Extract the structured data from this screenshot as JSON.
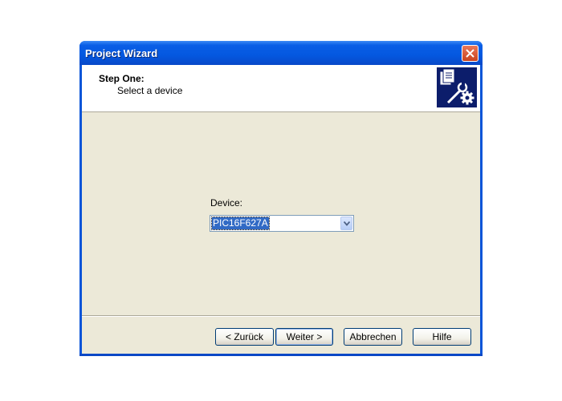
{
  "window": {
    "title": "Project Wizard"
  },
  "header": {
    "step_title": "Step One:",
    "step_subtitle": "Select a device",
    "icon": "wizard-gear-wrench-icon"
  },
  "device": {
    "label": "Device:",
    "selected_value": "PIC16F627A"
  },
  "buttons": {
    "back": "< Zurück",
    "next": "Weiter >",
    "cancel": "Abbrechen",
    "help": "Hilfe"
  },
  "colors": {
    "titlebar": "#0458e0",
    "dialog_bg": "#ece9d8",
    "selection": "#316ac5"
  }
}
